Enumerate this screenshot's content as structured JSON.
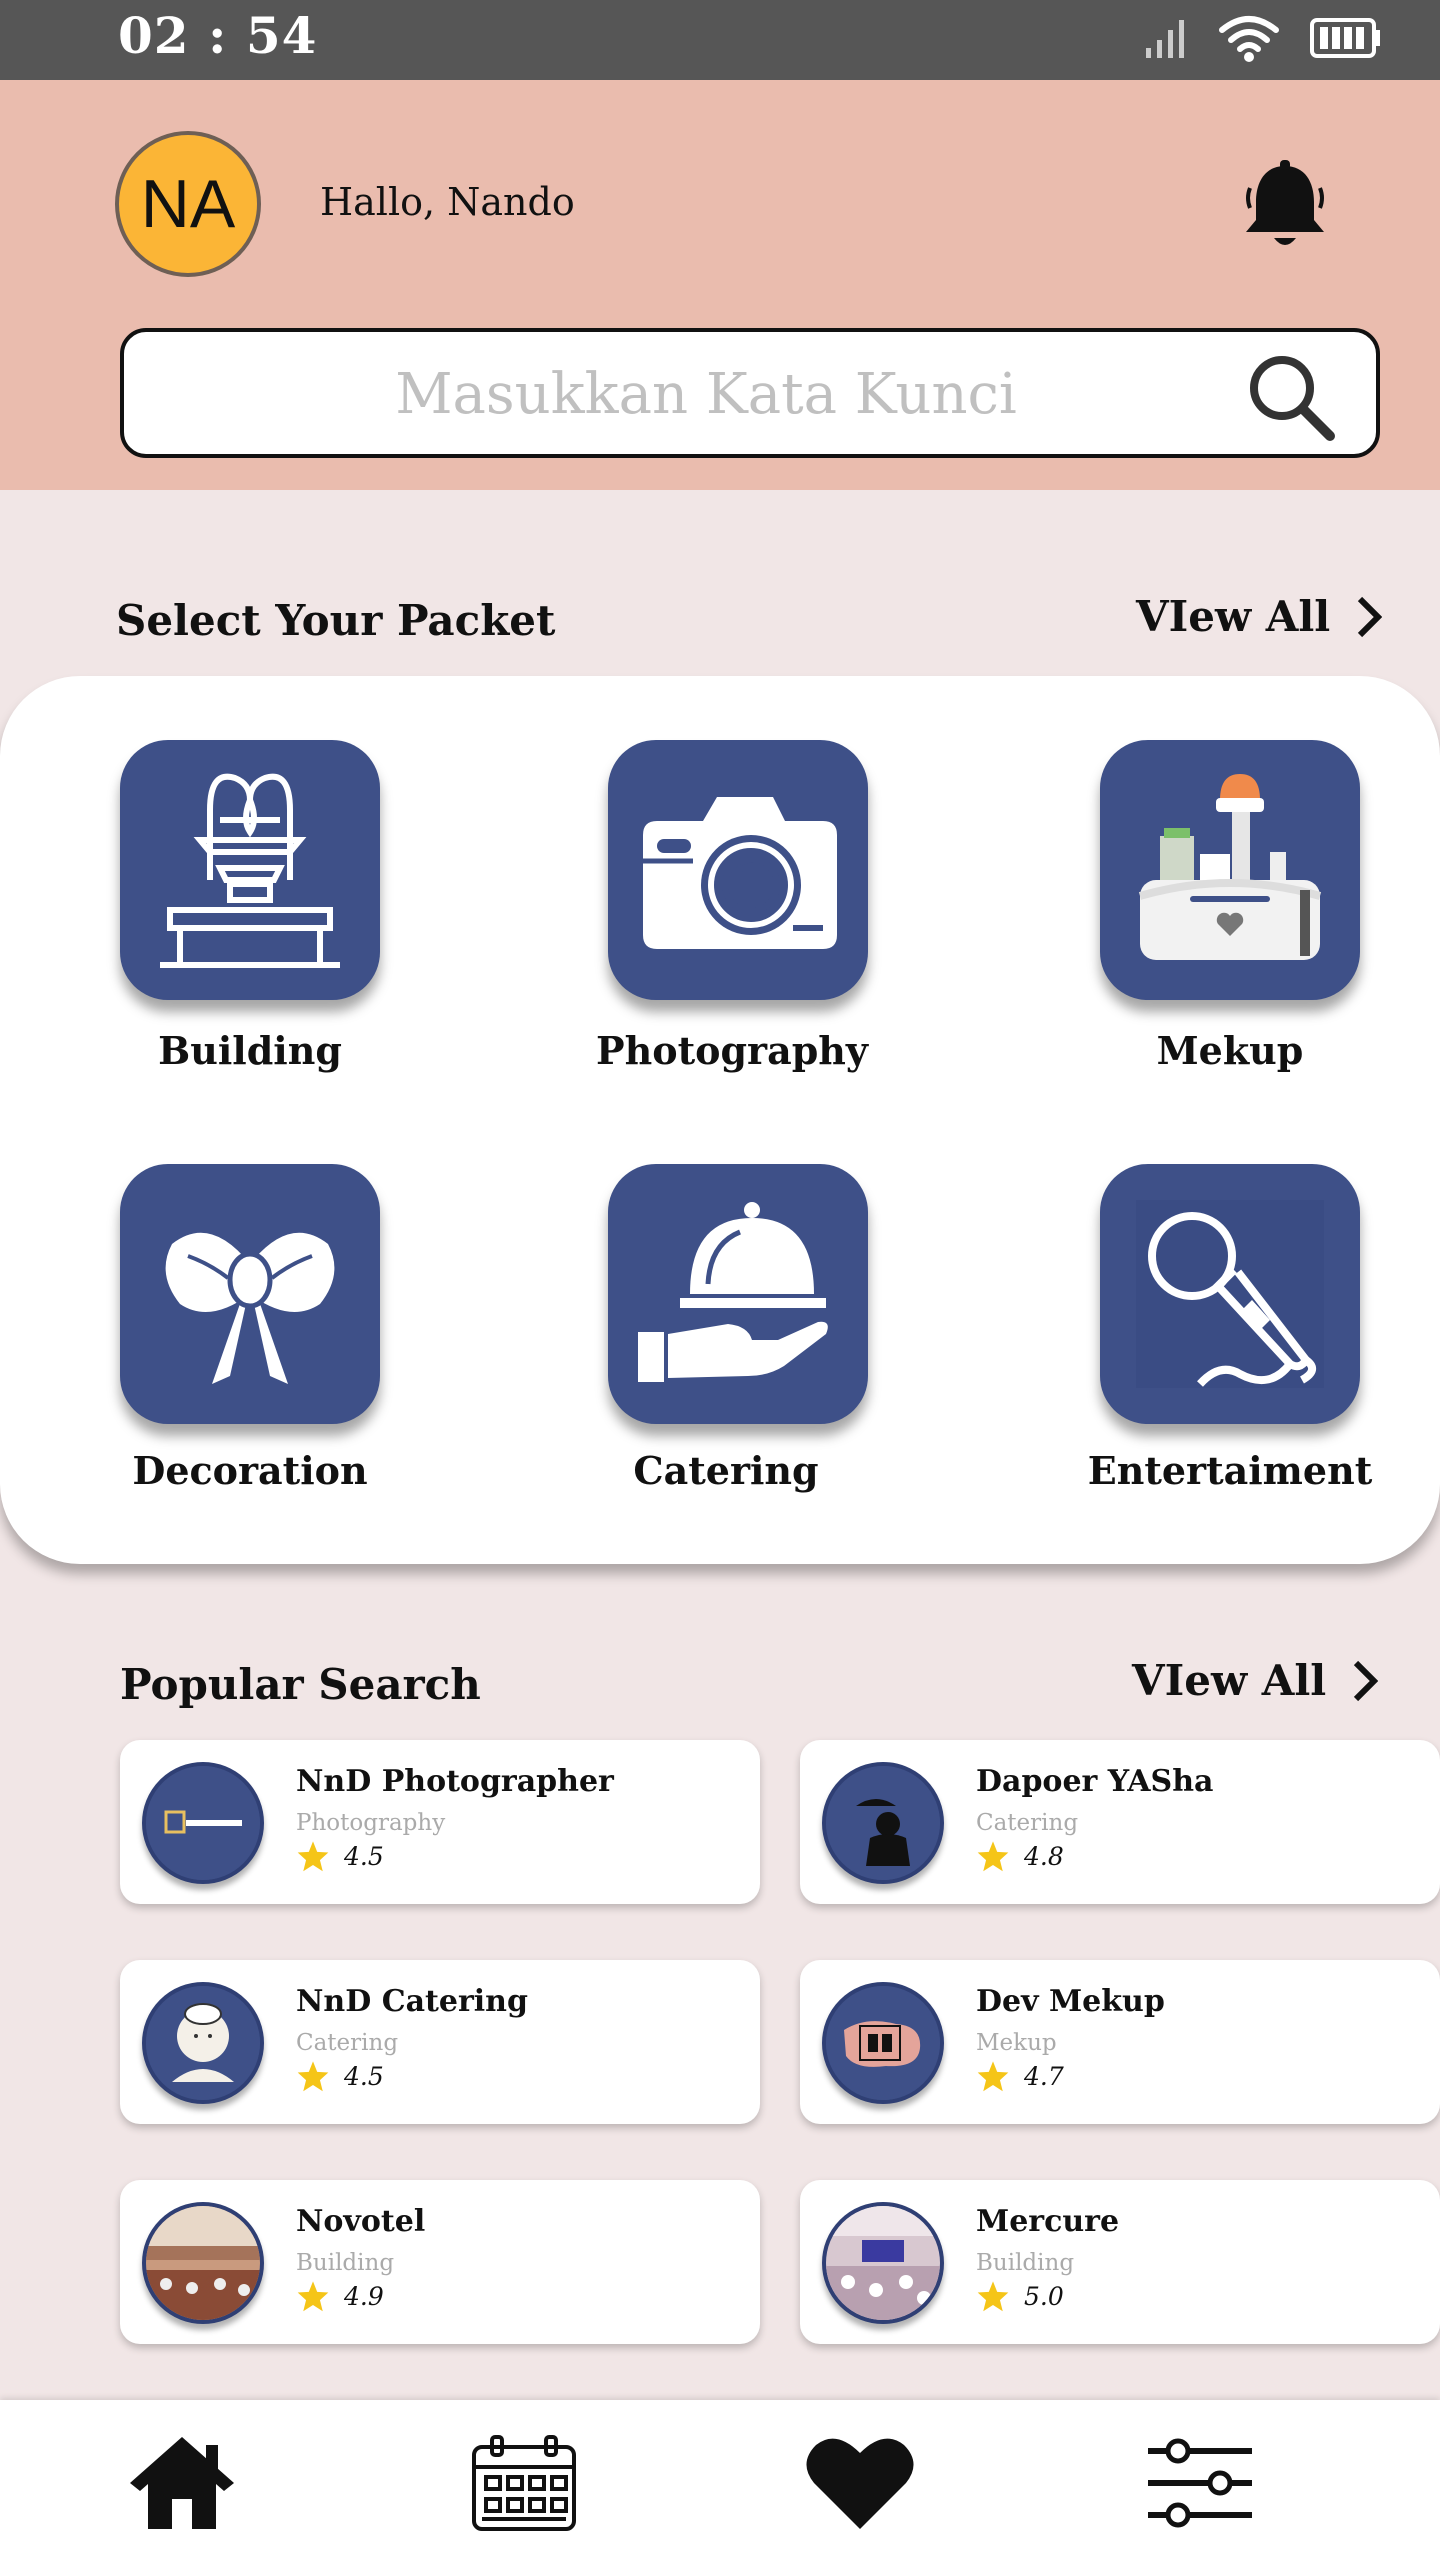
{
  "status_bar": {
    "time": "02 : 54"
  },
  "header": {
    "avatar_initials": "NA",
    "greeting": "Hallo, Nando",
    "search_placeholder": "Masukkan Kata Kunci"
  },
  "packets": {
    "title": "Select Your Packet",
    "view_all": "VIew All",
    "items": [
      {
        "label": "Building",
        "icon": "fountain-icon"
      },
      {
        "label": "Photography",
        "icon": "camera-icon"
      },
      {
        "label": "Mekup",
        "icon": "makeup-kit-icon"
      },
      {
        "label": "Decoration",
        "icon": "ribbon-bow-icon"
      },
      {
        "label": "Catering",
        "icon": "serving-cloche-icon"
      },
      {
        "label": "Entertaiment",
        "icon": "microphone-icon"
      }
    ]
  },
  "popular": {
    "title": "Popular Search",
    "view_all": "VIew All",
    "items": [
      {
        "name": "NnD Photographer",
        "category": "Photography",
        "rating": "4.5"
      },
      {
        "name": "Dapoer YASha",
        "category": "Catering",
        "rating": "4.8"
      },
      {
        "name": "NnD Catering",
        "category": "Catering",
        "rating": "4.5"
      },
      {
        "name": "Dev Mekup",
        "category": "Mekup",
        "rating": "4.7"
      },
      {
        "name": "Novotel",
        "category": "Building",
        "rating": "4.9"
      },
      {
        "name": "Mercure",
        "category": "Building",
        "rating": "5.0"
      }
    ]
  },
  "bottom_nav": [
    "home-icon",
    "calendar-icon",
    "heart-icon",
    "settings-sliders-icon"
  ],
  "colors": {
    "header_bg": "#eabcae",
    "icon_tile": "#3e5088",
    "avatar": "#fbb536",
    "star": "#f5c518",
    "page_bg": "#f1e6e6"
  }
}
